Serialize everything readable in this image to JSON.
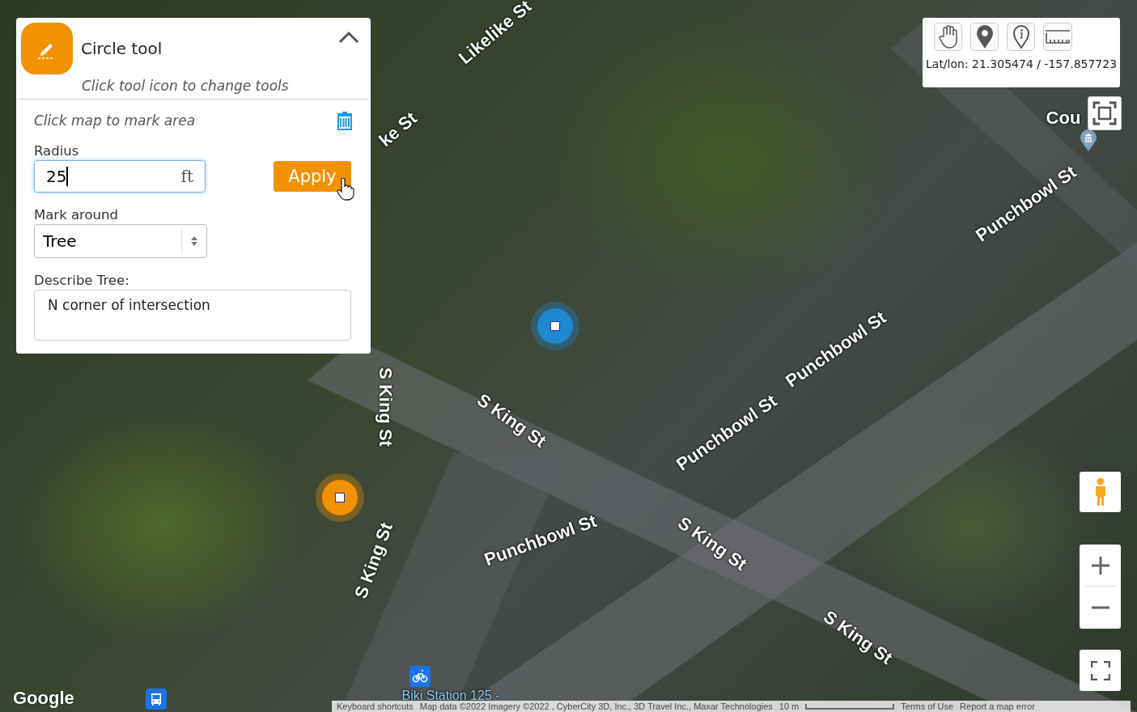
{
  "tool_panel": {
    "title": "Circle tool",
    "hint": "Click tool icon to change tools",
    "expanded": true,
    "instruction": "Click map to mark area",
    "radius": {
      "label": "Radius",
      "value": "25",
      "unit": "ft"
    },
    "apply_button": "Apply",
    "mark_around": {
      "label": "Mark around",
      "value": "Tree"
    },
    "describe": {
      "label": "Describe Tree:",
      "value": "N corner of intersection"
    }
  },
  "map_toolbar": {
    "tools": [
      {
        "kind": "pan"
      },
      {
        "kind": "pin"
      },
      {
        "kind": "info"
      },
      {
        "kind": "measure"
      }
    ],
    "coordinates": "Lat/lon: 21.305474 / -157.857723"
  },
  "map_labels": [
    "Likelike St",
    "ke St",
    "Punchbowl St",
    "Punchbowl St",
    "Punchbowl St",
    "S King St",
    "S King St",
    "S King St",
    "Punchbowl St",
    "S King St",
    "S King St",
    "Cou",
    "Biki Station 125 -"
  ],
  "markers": [
    {
      "color": "#1e88d0"
    },
    {
      "color": "#f39200"
    }
  ],
  "brand": "Google",
  "attribution": [
    "Keyboard shortcuts",
    "Map data ©2022 Imagery ©2022 , CyberCity 3D, Inc., 3D Travel Inc., Maxar Technologies",
    "10 m",
    "Terms of Use",
    "Report a map error"
  ]
}
